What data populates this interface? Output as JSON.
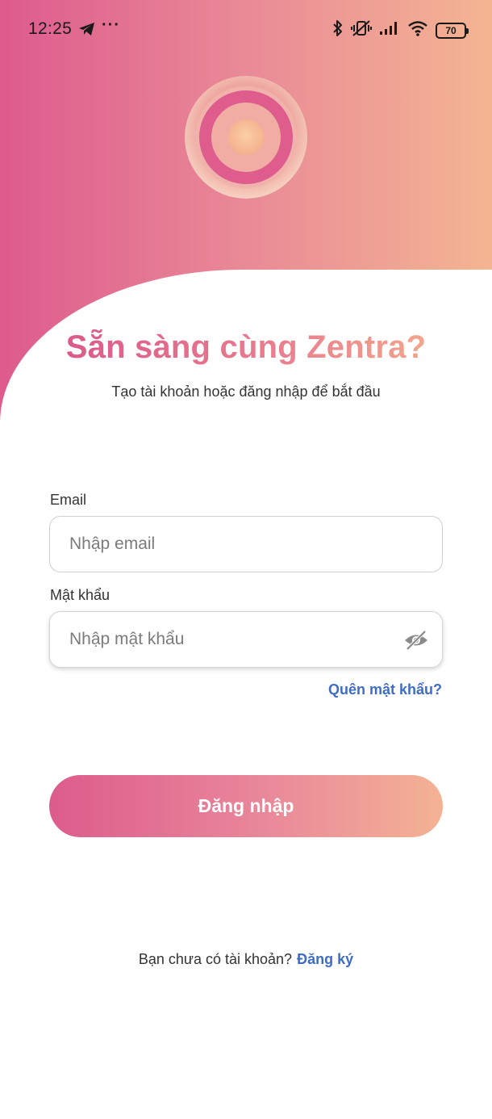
{
  "status_bar": {
    "time": "12:25",
    "more": "···",
    "battery": "70",
    "icons": [
      "telegram-icon",
      "bluetooth-icon",
      "vibrate-off-icon",
      "signal-icon",
      "wifi-icon",
      "battery-icon"
    ]
  },
  "brand": {
    "logo": "concentric-ring-logo",
    "colors": {
      "primary": "#dd5b8d",
      "secondary": "#f4b592",
      "link": "#3f6cc4"
    }
  },
  "heading": {
    "title": "Sẵn sàng cùng Zentra?",
    "subtitle": "Tạo tài khoản hoặc đăng nhập để bắt đầu"
  },
  "form": {
    "email_label": "Email",
    "email_placeholder": "Nhập email",
    "email_value": "",
    "password_label": "Mật khẩu",
    "password_placeholder": "Nhập mật khẩu",
    "password_value": "",
    "password_toggle_icon": "eye-off-icon",
    "forgot_label": "Quên mật khẩu?",
    "login_label": "Đăng nhập"
  },
  "footer": {
    "prompt": "Bạn chưa có tài khoản?",
    "signup_label": "Đăng ký"
  }
}
